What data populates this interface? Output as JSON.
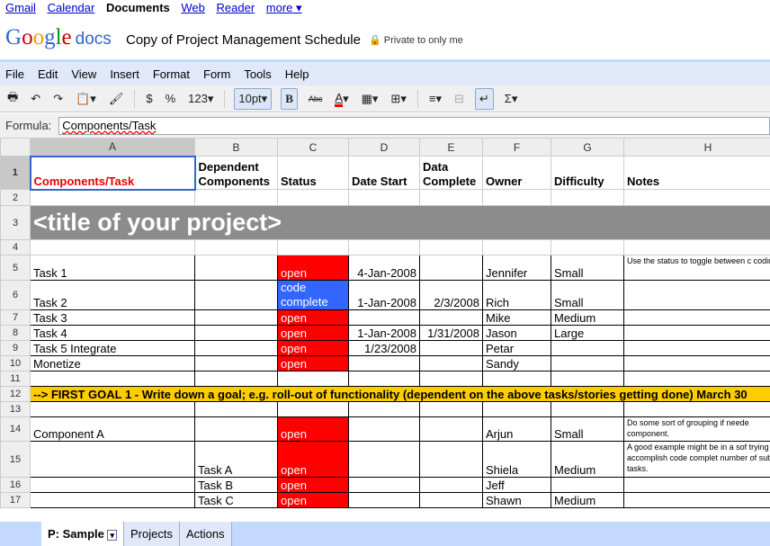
{
  "topnav": {
    "gmail": "Gmail",
    "calendar": "Calendar",
    "documents": "Documents",
    "web": "Web",
    "reader": "Reader",
    "more": "more ▾"
  },
  "header": {
    "logo": "Google",
    "logo_docs": "docs",
    "title": "Copy of Project Management Schedule",
    "privacy": "Private to only me"
  },
  "menu": [
    "File",
    "Edit",
    "View",
    "Insert",
    "Format",
    "Form",
    "Tools",
    "Help"
  ],
  "toolbar": {
    "dollar": "$",
    "percent": "%",
    "number": "123",
    "font_size": "10pt",
    "bold": "B",
    "strike": "Abc",
    "text_color": "A",
    "sum": "Σ"
  },
  "formula": {
    "label": "Formula:",
    "value": "Components/Task"
  },
  "columns": [
    "A",
    "B",
    "C",
    "D",
    "E",
    "F",
    "G",
    "H"
  ],
  "rows": [
    {
      "n": "1",
      "a": "Components/Task",
      "b": "Dependent Components",
      "c": "Status",
      "d": "Date Start",
      "e": "Data Complete",
      "f": "Owner",
      "g": "Difficulty",
      "h": "Notes"
    },
    {
      "n": "2"
    },
    {
      "n": "3",
      "title": "<title of your project>"
    },
    {
      "n": "4"
    },
    {
      "n": "5",
      "a": "Task 1",
      "c": "open",
      "d": "4-Jan-2008",
      "f": "Jennifer",
      "g": "Small",
      "h": "Use the status to toggle between c coding."
    },
    {
      "n": "6",
      "a": "Task 2",
      "c": "code complete",
      "d": "1-Jan-2008",
      "e": "2/3/2008",
      "f": "Rich",
      "g": "Small"
    },
    {
      "n": "7",
      "a": "Task 3",
      "c": "open",
      "f": "Mike",
      "g": "Medium"
    },
    {
      "n": "8",
      "a": "Task 4",
      "c": "open",
      "d": "1-Jan-2008",
      "e": "1/31/2008",
      "f": "Jason",
      "g": "Large"
    },
    {
      "n": "9",
      "a": "Task 5 Integrate",
      "c": "open",
      "d": "1/23/2008",
      "f": "Petar"
    },
    {
      "n": "10",
      "a": "Monetize",
      "c": "open",
      "f": "Sandy"
    },
    {
      "n": "11"
    },
    {
      "n": "12",
      "goal": "--> FIRST GOAL 1 - Write down a goal; e.g. roll-out of functionality (dependent on the above tasks/stories getting done) March 30"
    },
    {
      "n": "13"
    },
    {
      "n": "14",
      "a": "Component A",
      "c": "open",
      "f": "Arjun",
      "g": "Small",
      "h": "Do some sort of grouping if neede component."
    },
    {
      "n": "15",
      "b": "Task A",
      "c": "open",
      "f": "Shiela",
      "g": "Medium",
      "h": "A good example might be in a sof trying to accomplish code complet number of sub tasks."
    },
    {
      "n": "16",
      "b": "Task B",
      "c": "open",
      "f": "Jeff"
    },
    {
      "n": "17",
      "b": "Task C",
      "c": "open",
      "f": "Shawn",
      "g": "Medium"
    }
  ],
  "sheet_tabs": [
    "P: Sample",
    "Projects",
    "Actions"
  ],
  "colors": {
    "status_open": "#ff0000",
    "status_code_complete": "#3366ff",
    "goal_row": "#ffcc00",
    "title_row": "#8c8c8c",
    "header_text": "#ff0000"
  }
}
